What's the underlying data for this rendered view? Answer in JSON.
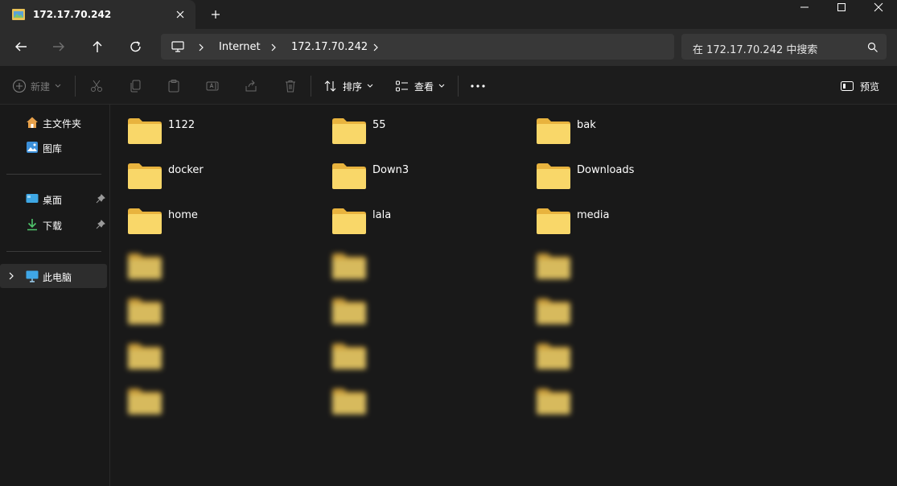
{
  "window": {
    "tab_title": "172.17.70.242"
  },
  "navigation": {
    "breadcrumb": [
      "Internet",
      "172.17.70.242"
    ],
    "search_placeholder": "在 172.17.70.242 中搜索"
  },
  "toolbar": {
    "new_label": "新建",
    "sort_label": "排序",
    "view_label": "查看",
    "preview_label": "预览"
  },
  "sidebar": {
    "items": [
      {
        "label": "主文件夹",
        "icon": "home-icon"
      },
      {
        "label": "图库",
        "icon": "gallery-icon"
      },
      {
        "label": "桌面",
        "icon": "desktop-icon",
        "pinned": true
      },
      {
        "label": "下载",
        "icon": "download-icon",
        "pinned": true
      },
      {
        "label": "此电脑",
        "icon": "this-pc-icon",
        "selected": true
      }
    ]
  },
  "folders": [
    {
      "name": "1122"
    },
    {
      "name": "55"
    },
    {
      "name": "bak"
    },
    {
      "name": "docker"
    },
    {
      "name": "Down3"
    },
    {
      "name": "Downloads"
    },
    {
      "name": "home"
    },
    {
      "name": "lala"
    },
    {
      "name": "media"
    },
    {
      "name": "",
      "blurred": true
    },
    {
      "name": "",
      "blurred": true
    },
    {
      "name": "",
      "blurred": true
    },
    {
      "name": "",
      "blurred": true
    },
    {
      "name": "",
      "blurred": true
    },
    {
      "name": "",
      "blurred": true
    },
    {
      "name": "",
      "blurred": true
    },
    {
      "name": "",
      "blurred": true
    },
    {
      "name": "",
      "blurred": true
    },
    {
      "name": "",
      "blurred": true
    },
    {
      "name": "",
      "blurred": true
    },
    {
      "name": "",
      "blurred": true
    }
  ],
  "colors": {
    "folder_front": "#f9d769",
    "folder_back": "#e8b33e",
    "accent": "#4ca8e0"
  }
}
